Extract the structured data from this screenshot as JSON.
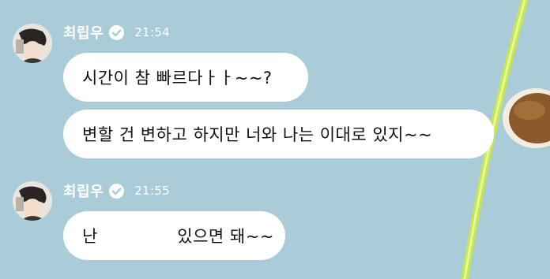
{
  "chat": {
    "groups": [
      {
        "sender": "최립우",
        "time": "21:54",
        "messages": [
          "시간이 참 빠르다ㅏㅏ~~?",
          "변할 건 변하고 하지만 너와 나는 이대로 있지~~"
        ]
      },
      {
        "sender": "최립우",
        "time": "21:55",
        "messages": [
          "난              있으면 돼~~"
        ]
      }
    ]
  },
  "colors": {
    "background": "#a9ccd8",
    "bubble": "#ffffff",
    "text": "#111111",
    "meta_text": "#ffffff",
    "decor_stroke": "#c8e84a",
    "decor_ball": "#8a5a2c"
  },
  "icons": {
    "verified": "verified-check-icon"
  }
}
